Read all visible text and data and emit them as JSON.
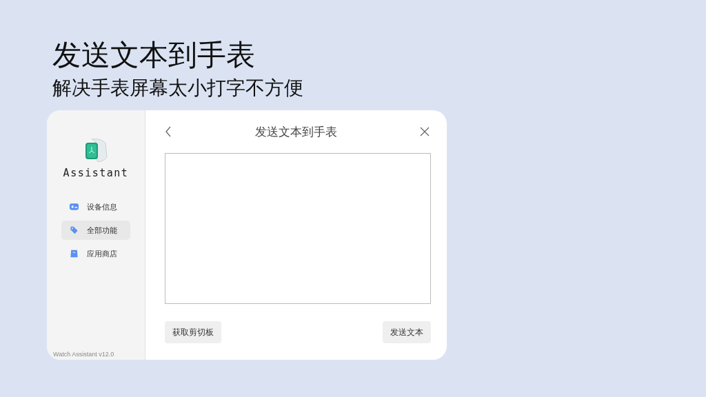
{
  "headline": "发送文本到手表",
  "subheadline": "解决手表屏幕太小打字不方便",
  "app": {
    "logo_text": "Assistant",
    "nav": [
      {
        "label": "设备信息",
        "selected": false
      },
      {
        "label": "全部功能",
        "selected": true
      },
      {
        "label": "应用商店",
        "selected": false
      }
    ],
    "version": "Watch Assistant v12.0",
    "page_title": "发送文本到手表",
    "buttons": [
      "获取剪切板",
      "发送文本"
    ]
  }
}
